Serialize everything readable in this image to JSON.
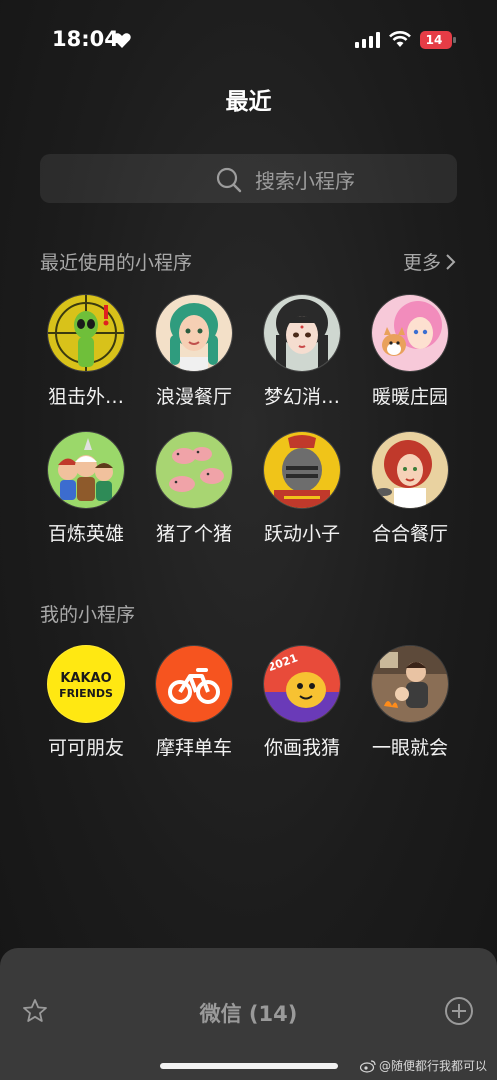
{
  "status_bar": {
    "time": "18:04",
    "battery": "14"
  },
  "header": {
    "title": "最近"
  },
  "search": {
    "placeholder": "搜索小程序"
  },
  "recent": {
    "title": "最近使用的小程序",
    "more_label": "更多",
    "apps": [
      {
        "label": "狙击外…",
        "icon": "alien-sniper-icon"
      },
      {
        "label": "浪漫餐厅",
        "icon": "green-hair-girl-icon"
      },
      {
        "label": "梦幻消…",
        "icon": "anime-girl-icon"
      },
      {
        "label": "暖暖庄园",
        "icon": "pink-hair-girl-dog-icon"
      },
      {
        "label": "百炼英雄",
        "icon": "heroes-group-icon"
      },
      {
        "label": "猪了个猪",
        "icon": "pigs-icon"
      },
      {
        "label": "跃动小子",
        "icon": "knight-helmet-icon"
      },
      {
        "label": "合合餐厅",
        "icon": "chef-girl-icon"
      }
    ]
  },
  "mine": {
    "title": "我的小程序",
    "apps": [
      {
        "label": "可可朋友",
        "icon_text_1": "KAKAO",
        "icon_text_2": "FRIENDS"
      },
      {
        "label": "摩拜单车",
        "icon": "bicycle-icon"
      },
      {
        "label": "你画我猜",
        "icon_text": "2021"
      },
      {
        "label": "一眼就会",
        "icon": "mother-baby-icon"
      }
    ]
  },
  "bottom": {
    "title": "微信 (14)"
  },
  "watermark": {
    "text": "@随便都行我都可以"
  },
  "colors": {
    "background": "#1c1c1c",
    "battery": "#e63c46",
    "mobike": "#f6541f",
    "kakao": "#ffe812"
  }
}
